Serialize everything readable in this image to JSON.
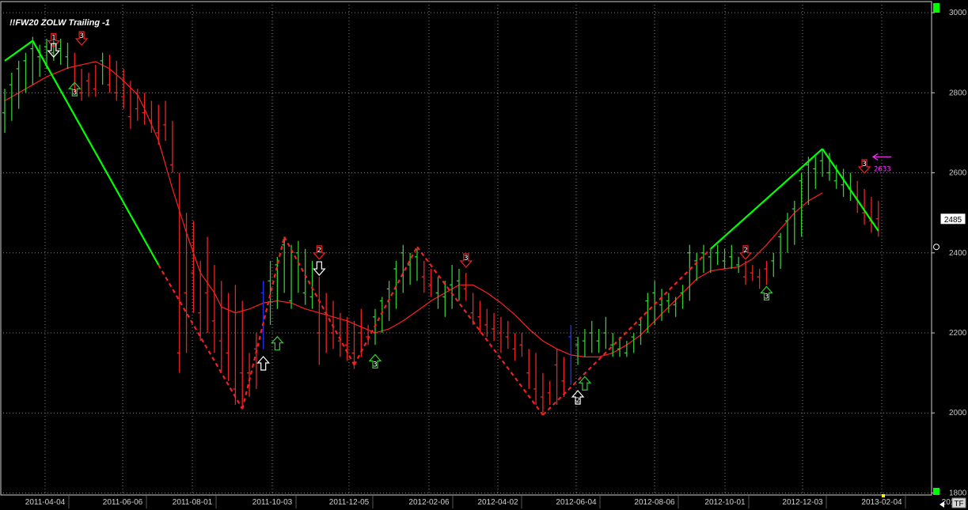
{
  "chart_data": {
    "type": "bar",
    "title": "!!FW20 ZOLW Trailing -1",
    "y_ticks": [
      1800,
      2000,
      2200,
      2400,
      2600,
      2800,
      3000
    ],
    "ylim": [
      1795,
      3020
    ],
    "x_labels": [
      "2011-04-04",
      "2011-06-06",
      "2011-08-01",
      "2011-10-03",
      "2011-12-05",
      "2012-02-06",
      "2012-04-02",
      "2012-06-04",
      "2012-08-06",
      "2012-10-01",
      "2012-12-03",
      "2013-02-04",
      "201"
    ],
    "last_price": "2485",
    "price_annotation": "2633",
    "corner_label": "TF",
    "colors": {
      "up": "#33cc33",
      "down": "#ee2222",
      "bright_up": "#00ff00",
      "ma": "#ff2020",
      "accent": "#ff33ff",
      "special": "#2233ff"
    },
    "ma_line": [
      [
        0,
        2780
      ],
      [
        3,
        2810
      ],
      [
        6,
        2840
      ],
      [
        9,
        2862
      ],
      [
        11,
        2870
      ],
      [
        13,
        2878
      ],
      [
        15,
        2860
      ],
      [
        17,
        2830
      ],
      [
        19,
        2795
      ],
      [
        20,
        2760
      ],
      [
        22,
        2680
      ],
      [
        24,
        2560
      ],
      [
        26,
        2450
      ],
      [
        28,
        2350
      ],
      [
        30,
        2300
      ],
      [
        31,
        2265
      ],
      [
        33,
        2250
      ],
      [
        35,
        2260
      ],
      [
        37,
        2275
      ],
      [
        39,
        2280
      ],
      [
        41,
        2275
      ],
      [
        43,
        2260
      ],
      [
        45,
        2250
      ],
      [
        47,
        2240
      ],
      [
        49,
        2230
      ],
      [
        51,
        2215
      ],
      [
        53,
        2200
      ],
      [
        55,
        2210
      ],
      [
        57,
        2230
      ],
      [
        59,
        2255
      ],
      [
        61,
        2280
      ],
      [
        63,
        2300
      ],
      [
        65,
        2320
      ],
      [
        67,
        2320
      ],
      [
        69,
        2300
      ],
      [
        71,
        2275
      ],
      [
        73,
        2245
      ],
      [
        75,
        2210
      ],
      [
        77,
        2180
      ],
      [
        79,
        2160
      ],
      [
        81,
        2145
      ],
      [
        83,
        2140
      ],
      [
        85,
        2140
      ],
      [
        87,
        2150
      ],
      [
        89,
        2170
      ],
      [
        91,
        2195
      ],
      [
        93,
        2230
      ],
      [
        95,
        2265
      ],
      [
        97,
        2300
      ],
      [
        99,
        2335
      ],
      [
        101,
        2355
      ],
      [
        103,
        2360
      ],
      [
        105,
        2365
      ],
      [
        107,
        2385
      ],
      [
        109,
        2420
      ],
      [
        111,
        2460
      ],
      [
        113,
        2500
      ],
      [
        115,
        2530
      ],
      [
        117,
        2550
      ]
    ],
    "zigzag": [
      {
        "x": 0,
        "y": 2880,
        "dashed": false
      },
      {
        "x": 4,
        "y": 2930,
        "dashed": false
      },
      {
        "x": 22,
        "y": 2370,
        "dashed": false
      },
      {
        "x": 34,
        "y": 2010,
        "dashed": true
      },
      {
        "x": 40,
        "y": 2440,
        "dashed": true
      },
      {
        "x": 50,
        "y": 2120,
        "dashed": true
      },
      {
        "x": 59,
        "y": 2415,
        "dashed": true
      },
      {
        "x": 77,
        "y": 1995,
        "dashed": true
      },
      {
        "x": 101,
        "y": 2410,
        "dashed": true
      },
      {
        "x": 117,
        "y": 2660,
        "dashed": false
      },
      {
        "x": 125,
        "y": 2455,
        "dashed": false
      }
    ],
    "bars": [
      {
        "x": 0,
        "h": 2810,
        "l": 2700,
        "c": 2750,
        "d": "up"
      },
      {
        "x": 1,
        "h": 2850,
        "l": 2730,
        "c": 2820,
        "d": "up"
      },
      {
        "x": 2,
        "h": 2880,
        "l": 2760,
        "c": 2860,
        "d": "up"
      },
      {
        "x": 3,
        "h": 2900,
        "l": 2800,
        "c": 2880,
        "d": "up"
      },
      {
        "x": 4,
        "h": 2940,
        "l": 2820,
        "c": 2910,
        "d": "up"
      },
      {
        "x": 5,
        "h": 2920,
        "l": 2840,
        "c": 2890,
        "d": "up"
      },
      {
        "x": 6,
        "h": 2935,
        "l": 2860,
        "c": 2915,
        "d": "up"
      },
      {
        "x": 7,
        "h": 2930,
        "l": 2880,
        "c": 2900,
        "d": "up"
      },
      {
        "x": 8,
        "h": 2935,
        "l": 2870,
        "c": 2910,
        "d": "up"
      },
      {
        "x": 9,
        "h": 2925,
        "l": 2860,
        "c": 2890,
        "d": "up"
      },
      {
        "x": 10,
        "h": 2900,
        "l": 2800,
        "c": 2820,
        "d": "down"
      },
      {
        "x": 11,
        "h": 2860,
        "l": 2780,
        "c": 2800,
        "d": "down"
      },
      {
        "x": 12,
        "h": 2850,
        "l": 2790,
        "c": 2830,
        "d": "down"
      },
      {
        "x": 13,
        "h": 2870,
        "l": 2790,
        "c": 2810,
        "d": "down"
      },
      {
        "x": 14,
        "h": 2900,
        "l": 2820,
        "c": 2880,
        "d": "up"
      },
      {
        "x": 15,
        "h": 2895,
        "l": 2800,
        "c": 2820,
        "d": "down"
      },
      {
        "x": 16,
        "h": 2880,
        "l": 2780,
        "c": 2800,
        "d": "down"
      },
      {
        "x": 17,
        "h": 2860,
        "l": 2760,
        "c": 2790,
        "d": "down"
      },
      {
        "x": 18,
        "h": 2830,
        "l": 2710,
        "c": 2740,
        "d": "down"
      },
      {
        "x": 19,
        "h": 2810,
        "l": 2730,
        "c": 2760,
        "d": "down"
      },
      {
        "x": 20,
        "h": 2800,
        "l": 2720,
        "c": 2750,
        "d": "down"
      },
      {
        "x": 21,
        "h": 2780,
        "l": 2700,
        "c": 2730,
        "d": "down"
      },
      {
        "x": 22,
        "h": 2770,
        "l": 2670,
        "c": 2700,
        "d": "down"
      },
      {
        "x": 23,
        "h": 2780,
        "l": 2680,
        "c": 2720,
        "d": "down"
      },
      {
        "x": 24,
        "h": 2730,
        "l": 2600,
        "c": 2620,
        "d": "down"
      },
      {
        "x": 25,
        "h": 2600,
        "l": 2100,
        "c": 2150,
        "d": "down"
      },
      {
        "x": 26,
        "h": 2500,
        "l": 2150,
        "c": 2300,
        "d": "down"
      },
      {
        "x": 27,
        "h": 2480,
        "l": 2250,
        "c": 2350,
        "d": "down"
      },
      {
        "x": 28,
        "h": 2380,
        "l": 2180,
        "c": 2250,
        "d": "down"
      },
      {
        "x": 29,
        "h": 2440,
        "l": 2200,
        "c": 2300,
        "d": "down"
      },
      {
        "x": 30,
        "h": 2370,
        "l": 2150,
        "c": 2230,
        "d": "down"
      },
      {
        "x": 31,
        "h": 2330,
        "l": 2100,
        "c": 2180,
        "d": "down"
      },
      {
        "x": 32,
        "h": 2300,
        "l": 2080,
        "c": 2150,
        "d": "down"
      },
      {
        "x": 33,
        "h": 2320,
        "l": 2020,
        "c": 2060,
        "d": "down"
      },
      {
        "x": 34,
        "h": 2280,
        "l": 2010,
        "c": 2100,
        "d": "down"
      },
      {
        "x": 35,
        "h": 2150,
        "l": 2040,
        "c": 2100,
        "d": "down"
      },
      {
        "x": 36,
        "h": 2200,
        "l": 2060,
        "c": 2160,
        "d": "down"
      },
      {
        "x": 37,
        "h": 2330,
        "l": 2160,
        "c": 2300,
        "d": "special"
      },
      {
        "x": 38,
        "h": 2380,
        "l": 2220,
        "c": 2330,
        "d": "up"
      },
      {
        "x": 39,
        "h": 2390,
        "l": 2260,
        "c": 2370,
        "d": "up"
      },
      {
        "x": 40,
        "h": 2440,
        "l": 2300,
        "c": 2420,
        "d": "up"
      },
      {
        "x": 41,
        "h": 2420,
        "l": 2260,
        "c": 2280,
        "d": "up"
      },
      {
        "x": 42,
        "h": 2430,
        "l": 2300,
        "c": 2400,
        "d": "up"
      },
      {
        "x": 43,
        "h": 2410,
        "l": 2270,
        "c": 2300,
        "d": "up"
      },
      {
        "x": 44,
        "h": 2380,
        "l": 2260,
        "c": 2290,
        "d": "up"
      },
      {
        "x": 45,
        "h": 2340,
        "l": 2120,
        "c": 2200,
        "d": "down"
      },
      {
        "x": 46,
        "h": 2300,
        "l": 2150,
        "c": 2250,
        "d": "down"
      },
      {
        "x": 47,
        "h": 2280,
        "l": 2160,
        "c": 2200,
        "d": "down"
      },
      {
        "x": 48,
        "h": 2250,
        "l": 2140,
        "c": 2180,
        "d": "down"
      },
      {
        "x": 49,
        "h": 2240,
        "l": 2130,
        "c": 2170,
        "d": "down"
      },
      {
        "x": 50,
        "h": 2230,
        "l": 2110,
        "c": 2150,
        "d": "down"
      },
      {
        "x": 51,
        "h": 2260,
        "l": 2140,
        "c": 2200,
        "d": "down"
      },
      {
        "x": 52,
        "h": 2220,
        "l": 2170,
        "c": 2190,
        "d": "down"
      },
      {
        "x": 53,
        "h": 2260,
        "l": 2170,
        "c": 2240,
        "d": "up"
      },
      {
        "x": 54,
        "h": 2290,
        "l": 2200,
        "c": 2280,
        "d": "up"
      },
      {
        "x": 55,
        "h": 2330,
        "l": 2230,
        "c": 2310,
        "d": "up"
      },
      {
        "x": 56,
        "h": 2380,
        "l": 2260,
        "c": 2360,
        "d": "up"
      },
      {
        "x": 57,
        "h": 2420,
        "l": 2300,
        "c": 2400,
        "d": "up"
      },
      {
        "x": 58,
        "h": 2400,
        "l": 2320,
        "c": 2370,
        "d": "up"
      },
      {
        "x": 59,
        "h": 2410,
        "l": 2330,
        "c": 2390,
        "d": "up"
      },
      {
        "x": 60,
        "h": 2380,
        "l": 2300,
        "c": 2340,
        "d": "down"
      },
      {
        "x": 61,
        "h": 2360,
        "l": 2290,
        "c": 2320,
        "d": "down"
      },
      {
        "x": 62,
        "h": 2340,
        "l": 2260,
        "c": 2300,
        "d": "up"
      },
      {
        "x": 63,
        "h": 2330,
        "l": 2240,
        "c": 2290,
        "d": "up"
      },
      {
        "x": 64,
        "h": 2370,
        "l": 2260,
        "c": 2320,
        "d": "up"
      },
      {
        "x": 65,
        "h": 2360,
        "l": 2280,
        "c": 2330,
        "d": "up"
      },
      {
        "x": 66,
        "h": 2350,
        "l": 2280,
        "c": 2310,
        "d": "down"
      },
      {
        "x": 67,
        "h": 2300,
        "l": 2220,
        "c": 2250,
        "d": "down"
      },
      {
        "x": 68,
        "h": 2280,
        "l": 2200,
        "c": 2240,
        "d": "down"
      },
      {
        "x": 69,
        "h": 2260,
        "l": 2190,
        "c": 2220,
        "d": "down"
      },
      {
        "x": 70,
        "h": 2250,
        "l": 2180,
        "c": 2210,
        "d": "down"
      },
      {
        "x": 71,
        "h": 2240,
        "l": 2150,
        "c": 2200,
        "d": "down"
      },
      {
        "x": 72,
        "h": 2230,
        "l": 2160,
        "c": 2190,
        "d": "down"
      },
      {
        "x": 73,
        "h": 2200,
        "l": 2130,
        "c": 2160,
        "d": "down"
      },
      {
        "x": 74,
        "h": 2200,
        "l": 2140,
        "c": 2170,
        "d": "down"
      },
      {
        "x": 75,
        "h": 2160,
        "l": 2060,
        "c": 2100,
        "d": "down"
      },
      {
        "x": 76,
        "h": 2150,
        "l": 2020,
        "c": 2060,
        "d": "down"
      },
      {
        "x": 77,
        "h": 2100,
        "l": 2000,
        "c": 2040,
        "d": "down"
      },
      {
        "x": 78,
        "h": 2080,
        "l": 2020,
        "c": 2050,
        "d": "down"
      },
      {
        "x": 79,
        "h": 2160,
        "l": 2020,
        "c": 2120,
        "d": "down"
      },
      {
        "x": 80,
        "h": 2140,
        "l": 2040,
        "c": 2080,
        "d": "down"
      },
      {
        "x": 81,
        "h": 2220,
        "l": 2070,
        "c": 2190,
        "d": "special"
      },
      {
        "x": 82,
        "h": 2190,
        "l": 2120,
        "c": 2170,
        "d": "up"
      },
      {
        "x": 83,
        "h": 2210,
        "l": 2140,
        "c": 2180,
        "d": "up"
      },
      {
        "x": 84,
        "h": 2230,
        "l": 2150,
        "c": 2200,
        "d": "up"
      },
      {
        "x": 85,
        "h": 2210,
        "l": 2150,
        "c": 2180,
        "d": "up"
      },
      {
        "x": 86,
        "h": 2240,
        "l": 2160,
        "c": 2200,
        "d": "up"
      },
      {
        "x": 87,
        "h": 2200,
        "l": 2140,
        "c": 2170,
        "d": "up"
      },
      {
        "x": 88,
        "h": 2190,
        "l": 2140,
        "c": 2160,
        "d": "up"
      },
      {
        "x": 89,
        "h": 2180,
        "l": 2140,
        "c": 2150,
        "d": "up"
      },
      {
        "x": 90,
        "h": 2200,
        "l": 2150,
        "c": 2190,
        "d": "up"
      },
      {
        "x": 91,
        "h": 2240,
        "l": 2170,
        "c": 2220,
        "d": "up"
      },
      {
        "x": 92,
        "h": 2300,
        "l": 2200,
        "c": 2280,
        "d": "up"
      },
      {
        "x": 93,
        "h": 2330,
        "l": 2220,
        "c": 2300,
        "d": "up"
      },
      {
        "x": 94,
        "h": 2310,
        "l": 2230,
        "c": 2270,
        "d": "up"
      },
      {
        "x": 95,
        "h": 2300,
        "l": 2250,
        "c": 2280,
        "d": "up"
      },
      {
        "x": 96,
        "h": 2290,
        "l": 2240,
        "c": 2270,
        "d": "up"
      },
      {
        "x": 97,
        "h": 2320,
        "l": 2260,
        "c": 2300,
        "d": "up"
      },
      {
        "x": 98,
        "h": 2420,
        "l": 2280,
        "c": 2400,
        "d": "up"
      },
      {
        "x": 99,
        "h": 2400,
        "l": 2330,
        "c": 2380,
        "d": "up"
      },
      {
        "x": 100,
        "h": 2420,
        "l": 2350,
        "c": 2400,
        "d": "up"
      },
      {
        "x": 101,
        "h": 2410,
        "l": 2350,
        "c": 2390,
        "d": "up"
      },
      {
        "x": 102,
        "h": 2420,
        "l": 2370,
        "c": 2400,
        "d": "up"
      },
      {
        "x": 103,
        "h": 2410,
        "l": 2360,
        "c": 2380,
        "d": "up"
      },
      {
        "x": 104,
        "h": 2420,
        "l": 2360,
        "c": 2390,
        "d": "up"
      },
      {
        "x": 105,
        "h": 2390,
        "l": 2350,
        "c": 2370,
        "d": "up"
      },
      {
        "x": 106,
        "h": 2380,
        "l": 2320,
        "c": 2340,
        "d": "down"
      },
      {
        "x": 107,
        "h": 2370,
        "l": 2330,
        "c": 2350,
        "d": "down"
      },
      {
        "x": 108,
        "h": 2360,
        "l": 2310,
        "c": 2340,
        "d": "down"
      },
      {
        "x": 109,
        "h": 2380,
        "l": 2320,
        "c": 2360,
        "d": "down"
      },
      {
        "x": 110,
        "h": 2400,
        "l": 2340,
        "c": 2380,
        "d": "up"
      },
      {
        "x": 111,
        "h": 2450,
        "l": 2360,
        "c": 2440,
        "d": "up"
      },
      {
        "x": 112,
        "h": 2500,
        "l": 2400,
        "c": 2480,
        "d": "up"
      },
      {
        "x": 113,
        "h": 2530,
        "l": 2420,
        "c": 2510,
        "d": "up"
      },
      {
        "x": 114,
        "h": 2600,
        "l": 2440,
        "c": 2580,
        "d": "up"
      },
      {
        "x": 115,
        "h": 2640,
        "l": 2520,
        "c": 2620,
        "d": "up"
      },
      {
        "x": 116,
        "h": 2640,
        "l": 2560,
        "c": 2610,
        "d": "up"
      },
      {
        "x": 117,
        "h": 2660,
        "l": 2590,
        "c": 2630,
        "d": "up"
      },
      {
        "x": 118,
        "h": 2650,
        "l": 2580,
        "c": 2600,
        "d": "up"
      },
      {
        "x": 119,
        "h": 2620,
        "l": 2560,
        "c": 2580,
        "d": "up"
      },
      {
        "x": 120,
        "h": 2610,
        "l": 2540,
        "c": 2570,
        "d": "up"
      },
      {
        "x": 121,
        "h": 2600,
        "l": 2530,
        "c": 2560,
        "d": "up"
      },
      {
        "x": 122,
        "h": 2580,
        "l": 2500,
        "c": 2540,
        "d": "down"
      },
      {
        "x": 123,
        "h": 2560,
        "l": 2470,
        "c": 2500,
        "d": "down"
      },
      {
        "x": 124,
        "h": 2540,
        "l": 2450,
        "c": 2480,
        "d": "down"
      },
      {
        "x": 125,
        "h": 2530,
        "l": 2440,
        "c": 2485,
        "d": "down"
      }
    ],
    "signals": [
      {
        "x": 7,
        "y": 2930,
        "label": "1",
        "kind": "down",
        "color": "#ee2222"
      },
      {
        "x": 7,
        "y": 2905,
        "label": "",
        "kind": "down",
        "color": "#ffffff"
      },
      {
        "x": 11,
        "y": 2935,
        "label": "3",
        "kind": "down",
        "color": "#ee2222"
      },
      {
        "x": 10,
        "y": 2810,
        "label": "3",
        "kind": "up",
        "color": "#33cc33"
      },
      {
        "x": 37,
        "y": 2125,
        "label": "",
        "kind": "up",
        "color": "#ffffff"
      },
      {
        "x": 39,
        "y": 2175,
        "label": "",
        "kind": "up",
        "color": "#33cc33"
      },
      {
        "x": 45,
        "y": 2400,
        "label": "2",
        "kind": "down",
        "color": "#ee2222"
      },
      {
        "x": 45,
        "y": 2360,
        "label": "",
        "kind": "down",
        "color": "#ffffff"
      },
      {
        "x": 53,
        "y": 2130,
        "label": "3",
        "kind": "up",
        "color": "#33cc33"
      },
      {
        "x": 66,
        "y": 2380,
        "label": "3",
        "kind": "down",
        "color": "#ee2222"
      },
      {
        "x": 82,
        "y": 2040,
        "label": "2",
        "kind": "up",
        "color": "#ffffff"
      },
      {
        "x": 83,
        "y": 2075,
        "label": "",
        "kind": "up",
        "color": "#33cc33"
      },
      {
        "x": 106,
        "y": 2400,
        "label": "2",
        "kind": "down",
        "color": "#ee2222"
      },
      {
        "x": 109,
        "y": 2300,
        "label": "3",
        "kind": "up",
        "color": "#33cc33"
      },
      {
        "x": 123,
        "y": 2615,
        "label": "3",
        "kind": "down",
        "color": "#ee2222"
      }
    ]
  }
}
